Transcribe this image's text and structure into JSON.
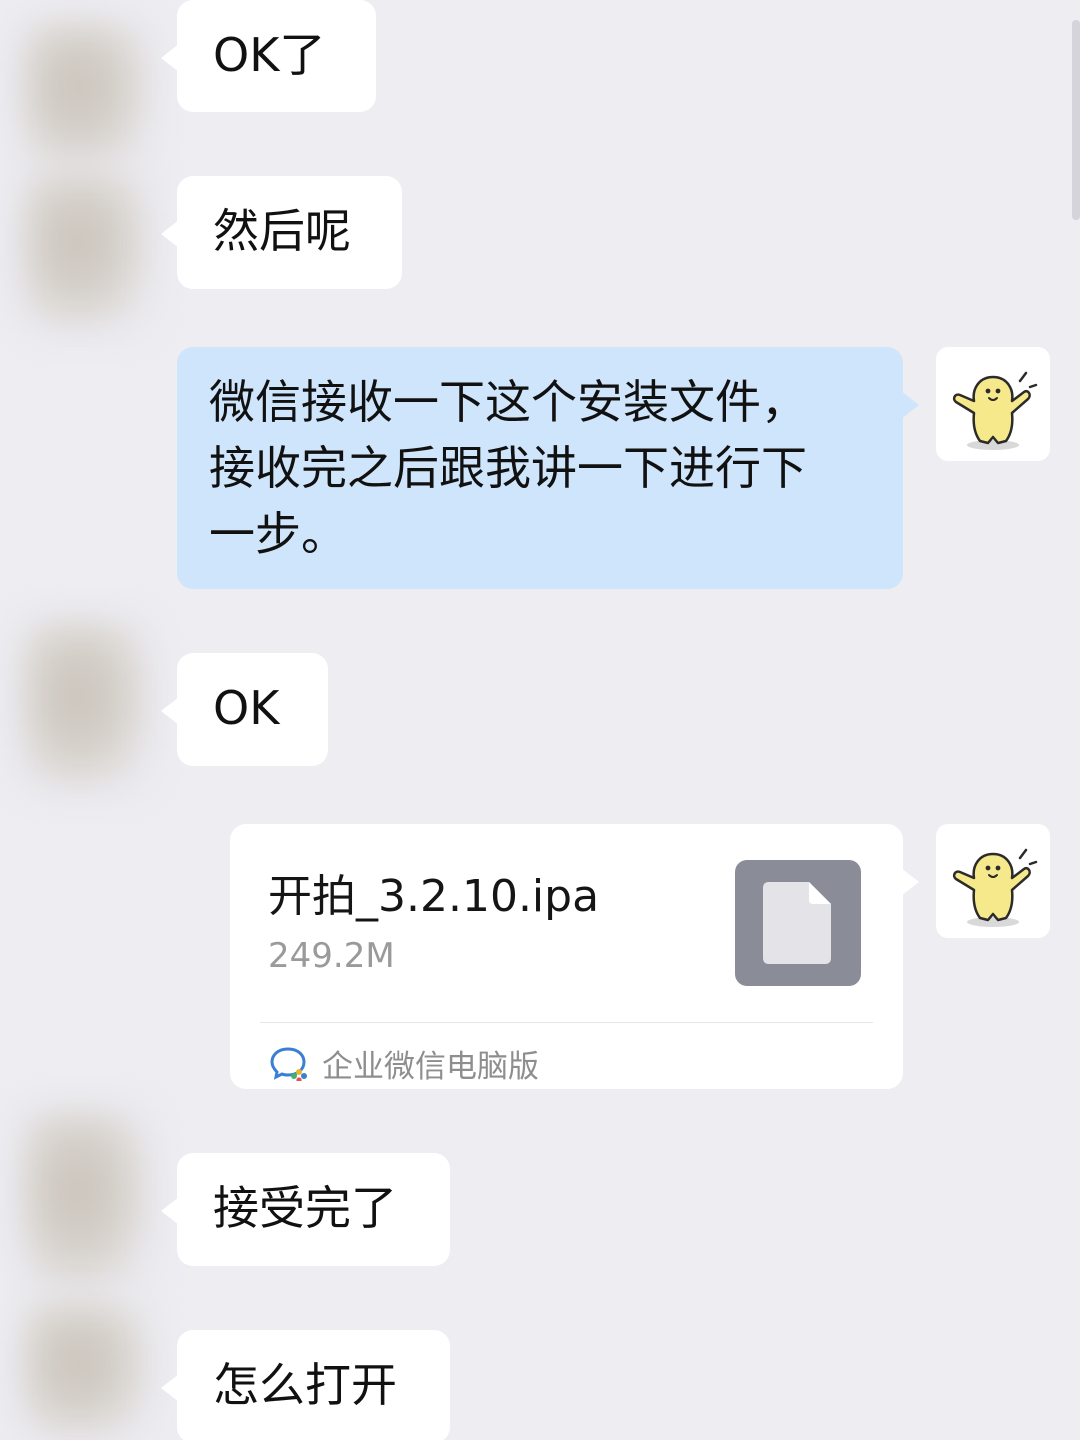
{
  "chat": {
    "messages": [
      {
        "direction": "incoming",
        "type": "text",
        "text": "OK了"
      },
      {
        "direction": "incoming",
        "type": "text",
        "text": "然后呢"
      },
      {
        "direction": "outgoing",
        "type": "text",
        "text": "微信接收一下这个安装文件，\n接收完之后跟我讲一下进行下\n一步。"
      },
      {
        "direction": "incoming",
        "type": "text",
        "text": "OK"
      },
      {
        "direction": "outgoing",
        "type": "file",
        "file_name": "开拍_3.2.10.ipa",
        "file_size": "249.2M",
        "source_label": "企业微信电脑版",
        "file_icon": "document-icon",
        "source_icon": "wecom-icon"
      },
      {
        "direction": "incoming",
        "type": "text",
        "text": "接受完了"
      },
      {
        "direction": "incoming",
        "type": "text",
        "text": "怎么打开"
      }
    ]
  },
  "colors": {
    "background": "#ededf2",
    "incoming_bubble": "#ffffff",
    "outgoing_bubble": "#cfe5fb",
    "file_icon_bg": "#8a8c98",
    "avatar_character": "#f6e98b"
  },
  "icons": {
    "self_avatar": "yellow-character-avatar",
    "file": "document-icon",
    "source": "wecom-icon"
  }
}
